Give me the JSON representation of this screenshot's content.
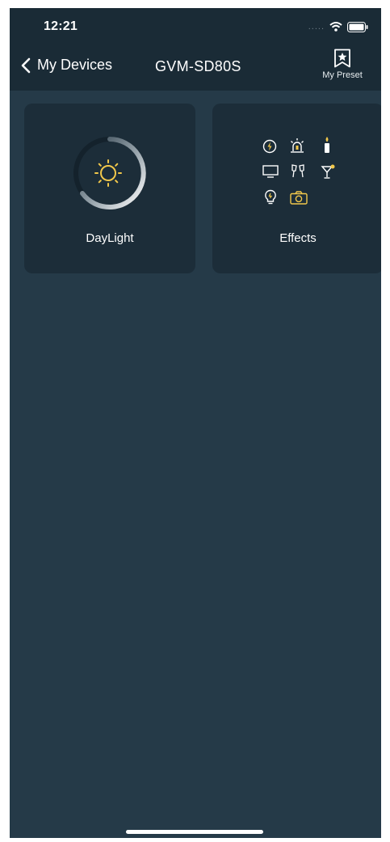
{
  "status_bar": {
    "time": "12:21",
    "signal_dots": "....."
  },
  "nav": {
    "back_label": "My Devices",
    "title": "GVM-SD80S",
    "preset_label": "My Preset"
  },
  "cards": [
    {
      "label": "DayLight",
      "icon": "sun-icon"
    },
    {
      "label": "Effects",
      "icon": "effects-grid-icon"
    }
  ],
  "colors": {
    "background": "#253a48",
    "header": "#1a2b36",
    "card": "#1c2d39",
    "accent": "#f2c84b"
  }
}
